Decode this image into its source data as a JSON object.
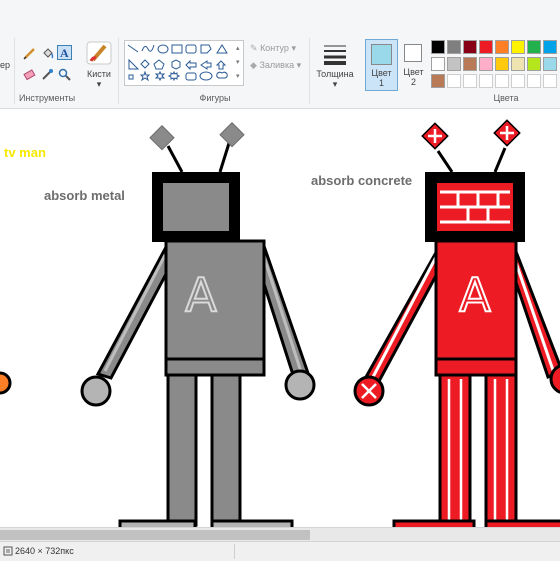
{
  "ribbon": {
    "clipboard_partial_label": "ер",
    "tools_group_label": "Инструменты",
    "brushes_label": "Кисти",
    "shapes_group_label": "Фигуры",
    "outline_label": "Контур",
    "fill_label": "Заливка",
    "thickness_label": "Толщина",
    "color1_label": "Цвет",
    "color1_num": "1",
    "color2_label": "Цвет",
    "color2_num": "2",
    "colors_group_label": "Цвета",
    "color1_value": "#99d9ea",
    "color2_value": "#ffffff",
    "palette_row1": [
      "#000000",
      "#7f7f7f",
      "#880015",
      "#ed1c24",
      "#ff7f27",
      "#fff200",
      "#22b14c",
      "#00a2e8"
    ],
    "palette_row2": [
      "#ffffff",
      "#c3c3c3",
      "#b97a57",
      "#ffaec9",
      "#ffc90e",
      "#efe4b0",
      "#b5e61d",
      "#99d9ea"
    ],
    "palette_row3": [
      "#b97a57"
    ]
  },
  "canvas": {
    "label_tv_man": "tv man",
    "label_metal": "absorb metal",
    "label_concrete": "absorb concrete",
    "screen_letter_metal": "A",
    "screen_letter_concrete": "A",
    "colors": {
      "tv_label": "#f5e900",
      "grey_label": "#6d6d6d",
      "metal": "#8a8a8a",
      "metal_light": "#b4b4b4",
      "concrete": "#ed1c24",
      "orange": "#ff7f27"
    }
  },
  "statusbar": {
    "dimensions": "2640 × 732пкс"
  }
}
